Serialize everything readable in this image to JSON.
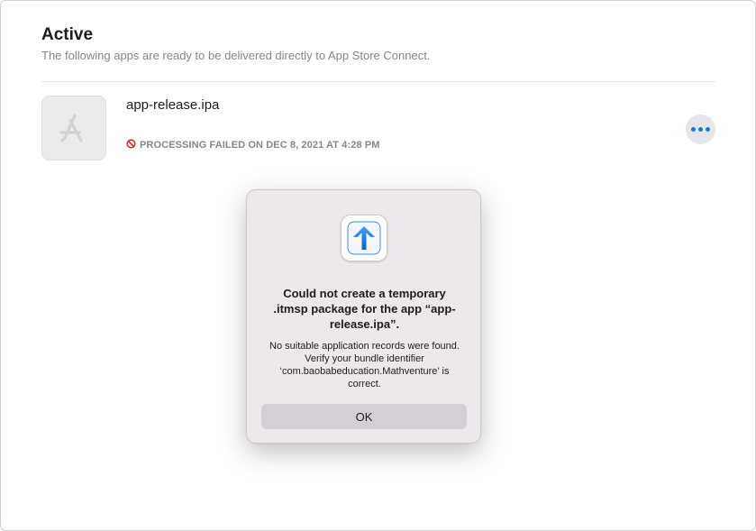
{
  "section": {
    "title": "Active",
    "subtitle": "The following apps are ready to be delivered directly to App Store Connect."
  },
  "app": {
    "name": "app-release.ipa",
    "status": "PROCESSING FAILED ON DEC 8, 2021 AT 4:28 PM",
    "icon": "app-store-icon",
    "status_icon": "prohibited-icon",
    "status_icon_color": "#d0312d",
    "more_icon": "ellipsis-icon"
  },
  "dialog": {
    "icon": "upload-arrow-icon",
    "title": "Could not create a temporary .itmsp package for the app “app-release.ipa”.",
    "message": "No suitable application records were found. Verify your bundle identifier ‘com.baobabeducation.Mathventure’ is correct.",
    "ok_label": "OK"
  },
  "colors": {
    "accent": "#1a73e8",
    "dialog_background": "#ede8ec"
  }
}
